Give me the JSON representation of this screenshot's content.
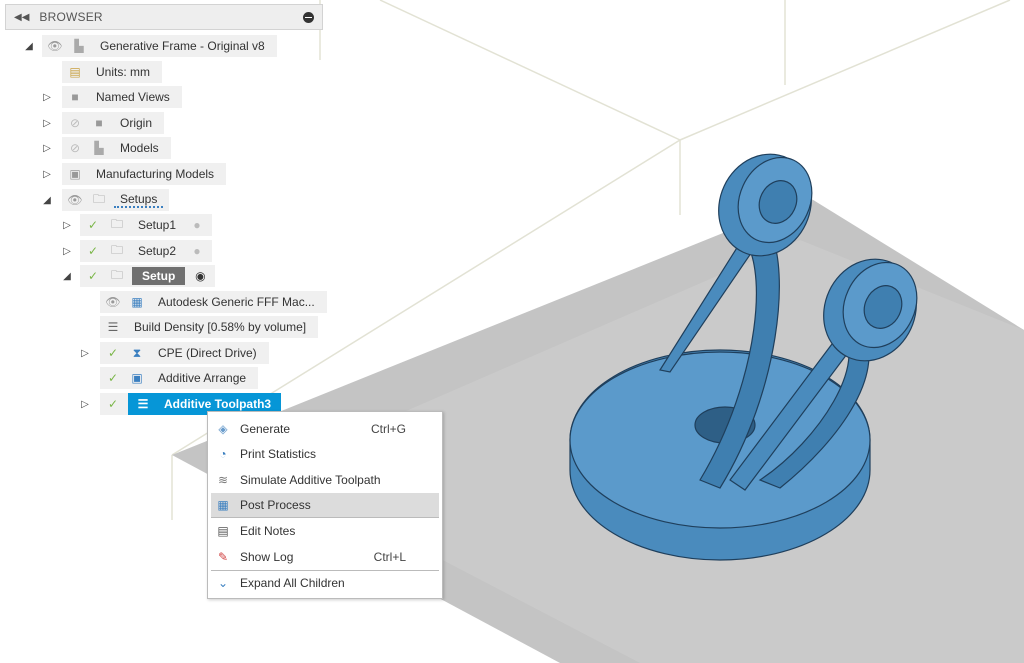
{
  "browser": {
    "title": "BROWSER"
  },
  "tree": [
    {
      "label": "Generative Frame - Original v8"
    },
    {
      "label": "Units: mm"
    },
    {
      "label": "Named Views"
    },
    {
      "label": "Origin"
    },
    {
      "label": "Models"
    },
    {
      "label": "Manufacturing Models"
    },
    {
      "label": "Setups"
    },
    {
      "label": "Setup1"
    },
    {
      "label": "Setup2"
    },
    {
      "label": "Setup"
    },
    {
      "label": "Autodesk Generic FFF Mac..."
    },
    {
      "label": "Build Density [0.58% by volume]"
    },
    {
      "label": "CPE (Direct Drive)"
    },
    {
      "label": "Additive Arrange"
    },
    {
      "label": "Additive Toolpath3"
    }
  ],
  "context_menu": [
    {
      "label": "Generate",
      "shortcut": "Ctrl+G"
    },
    {
      "label": "Print Statistics"
    },
    {
      "label": "Simulate Additive Toolpath"
    },
    {
      "label": "Post Process"
    },
    {
      "label": "Edit Notes"
    },
    {
      "label": "Show Log",
      "shortcut": "Ctrl+L"
    },
    {
      "label": "Expand All Children"
    }
  ],
  "colors": {
    "accent": "#0696d7",
    "model": "#4a8bbd",
    "platform": "#c4c4c4"
  }
}
